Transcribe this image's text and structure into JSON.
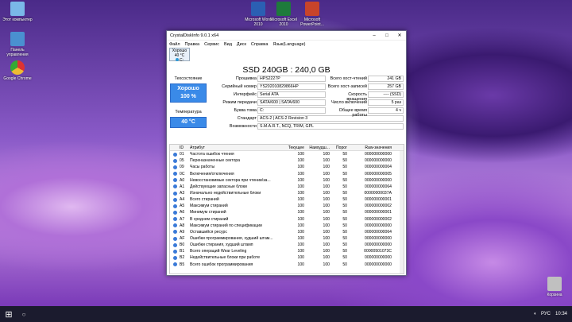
{
  "desktop": {
    "icons": [
      {
        "label": "Этот компьютер",
        "color": "#7ab8e8"
      },
      {
        "label": "Панель управления",
        "color": "#4a90d0"
      },
      {
        "label": "Google Chrome",
        "color": "#e0c040"
      },
      {
        "label": "Microsoft Word 2010",
        "color": "#2b5fb3"
      },
      {
        "label": "Microsoft Excel 2010",
        "color": "#1e7a3c"
      },
      {
        "label": "Microsoft PowerPoint...",
        "color": "#c8442a"
      },
      {
        "label": "Корзина",
        "color": "#c0c0c0"
      }
    ]
  },
  "window": {
    "title": "CrystalDiskInfo 9.0.1 x64",
    "menu": [
      "Файл",
      "Правка",
      "Сервис",
      "Вид",
      "Диск",
      "Справка",
      "Язык(Language)"
    ],
    "disk_tab": {
      "status": "Хорошо",
      "temp": "40 °C",
      "letter": "C:"
    },
    "headline": "SSD 240GB : 240,0 GB",
    "left": {
      "tech_label": "Техсостояние",
      "status_text": "Хорошо",
      "status_pct": "100 %",
      "temp_label": "Температура",
      "temp_value": "40 °C"
    },
    "fields": {
      "firmware_label": "Прошивка",
      "firmware": "HPS2227P",
      "serial_label": "Серийный номер",
      "serial": "YS202010829866HP",
      "interface_label": "Интерфейс",
      "interface": "Serial ATA",
      "transfer_label": "Режим передачи",
      "transfer": "SATA/600 | SATA/600",
      "volume_label": "Буква тома",
      "volume": "C:",
      "standard_label": "Стандарт",
      "standard": "ACS-2 | ACS-2 Revision 3",
      "features_label": "Возможности",
      "features": "S.M.A.R.T., NCQ, TRIM, GPL",
      "reads_label": "Всего хост-чтений",
      "reads": "241 GB",
      "writes_label": "Всего хост-записей",
      "writes": "257 GB",
      "rpm_label": "Скорость вращения",
      "rpm": "---- (SSD)",
      "power_on_count_label": "Число включений",
      "power_on_count": "5 раз",
      "power_on_hours_label": "Общее время работы",
      "power_on_hours": "4 ч"
    },
    "table": {
      "headers": [
        "ID",
        "Атрибут",
        "Текущее",
        "Наихудш...",
        "Порог",
        "Raw-значения"
      ],
      "rows": [
        [
          "01",
          "Частота ошибок чтения",
          "100",
          "100",
          "50",
          "000000000000"
        ],
        [
          "05",
          "Переназначенные сектора",
          "100",
          "100",
          "50",
          "000000000000"
        ],
        [
          "09",
          "Часы работы",
          "100",
          "100",
          "50",
          "000000000004"
        ],
        [
          "0C",
          "Включения/отключения",
          "100",
          "100",
          "50",
          "000000000005"
        ],
        [
          "A0",
          "Невосстановимые сектора при чтении/за...",
          "100",
          "100",
          "50",
          "000000000000"
        ],
        [
          "A1",
          "Действующие запасные блоки",
          "100",
          "100",
          "50",
          "000000000064"
        ],
        [
          "A3",
          "Изначально недействительные блоки",
          "100",
          "100",
          "50",
          "00000000037A"
        ],
        [
          "A4",
          "Всего стираний",
          "100",
          "100",
          "50",
          "000000000001"
        ],
        [
          "A5",
          "Максимум стираний",
          "100",
          "100",
          "50",
          "000000000002"
        ],
        [
          "A6",
          "Минимум стираний",
          "100",
          "100",
          "50",
          "000000000001"
        ],
        [
          "A7",
          "В среднем стираний",
          "100",
          "100",
          "50",
          "000000000002"
        ],
        [
          "A8",
          "Максимум стираний по спецификации",
          "100",
          "100",
          "50",
          "000000000000"
        ],
        [
          "A9",
          "Оставшийся ресурс",
          "100",
          "100",
          "50",
          "000000000064"
        ],
        [
          "AF",
          "Ошибки программирования, худший штам...",
          "100",
          "100",
          "50",
          "000000000000"
        ],
        [
          "B0",
          "Ошибки стирания, худший штамп",
          "100",
          "100",
          "50",
          "000000000000"
        ],
        [
          "B1",
          "Всего операций Wear Leveling",
          "100",
          "100",
          "50",
          "00000501073C"
        ],
        [
          "B2",
          "Недействительные блоки при работе",
          "100",
          "100",
          "50",
          "000000000000"
        ],
        [
          "B5",
          "Всего ошибок программирования",
          "100",
          "100",
          "50",
          "000000000000"
        ]
      ]
    }
  },
  "taskbar": {
    "lang": "РУС",
    "time": "10:34"
  },
  "colors": {
    "good": "#3a8ae8",
    "accent": "#2a9ad8"
  }
}
